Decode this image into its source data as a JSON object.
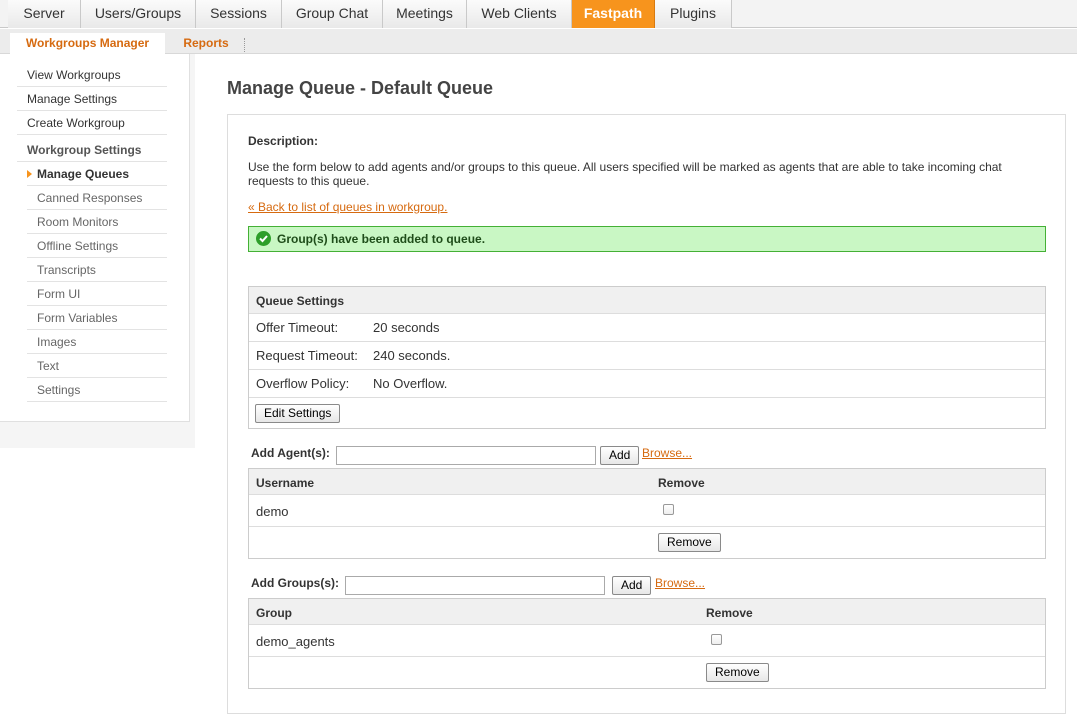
{
  "topnav": {
    "tabs": [
      "Server",
      "Users/Groups",
      "Sessions",
      "Group Chat",
      "Meetings",
      "Web Clients",
      "Fastpath",
      "Plugins"
    ],
    "active": "Fastpath"
  },
  "subnav": {
    "tabs": [
      "Workgroups Manager",
      "Reports"
    ]
  },
  "sidebar": {
    "items": [
      "View Workgroups",
      "Manage Settings",
      "Create Workgroup"
    ],
    "section_heading": "Workgroup Settings",
    "current": "Manage Queues",
    "subitems": [
      "Canned Responses",
      "Room Monitors",
      "Offline Settings",
      "Transcripts",
      "Form UI",
      "Form Variables",
      "Images",
      "Text",
      "Settings"
    ]
  },
  "main": {
    "title": "Manage Queue - Default Queue",
    "description_label": "Description:",
    "description_text": "Use the form below to add agents and/or groups to this queue. All users specified will be marked as agents that are able to take incoming chat requests to this queue.",
    "back_link": "« Back to list of queues in workgroup.",
    "success_message": "Group(s) have been added to queue."
  },
  "queue_settings": {
    "heading": "Queue Settings",
    "offer_timeout_label": "Offer Timeout:",
    "offer_timeout_value": "20 seconds",
    "request_timeout_label": "Request Timeout:",
    "request_timeout_value": "240 seconds.",
    "overflow_label": "Overflow Policy:",
    "overflow_value": "No Overflow.",
    "edit_button": "Edit Settings"
  },
  "agents": {
    "add_label": "Add Agent(s):",
    "input_value": "",
    "add_button": "Add",
    "browse_link": "Browse...",
    "col_username": "Username",
    "col_remove": "Remove",
    "rows": [
      "demo"
    ],
    "remove_button": "Remove"
  },
  "groups": {
    "add_label": "Add Groups(s):",
    "input_value": "",
    "add_button": "Add",
    "browse_link": "Browse...",
    "col_group": "Group",
    "col_remove": "Remove",
    "rows": [
      "demo_agents"
    ],
    "remove_button": "Remove"
  },
  "colors": {
    "accent": "#f7941d",
    "link": "#d66a10",
    "success_bg": "#c9f7c4",
    "success_border": "#44b035"
  }
}
